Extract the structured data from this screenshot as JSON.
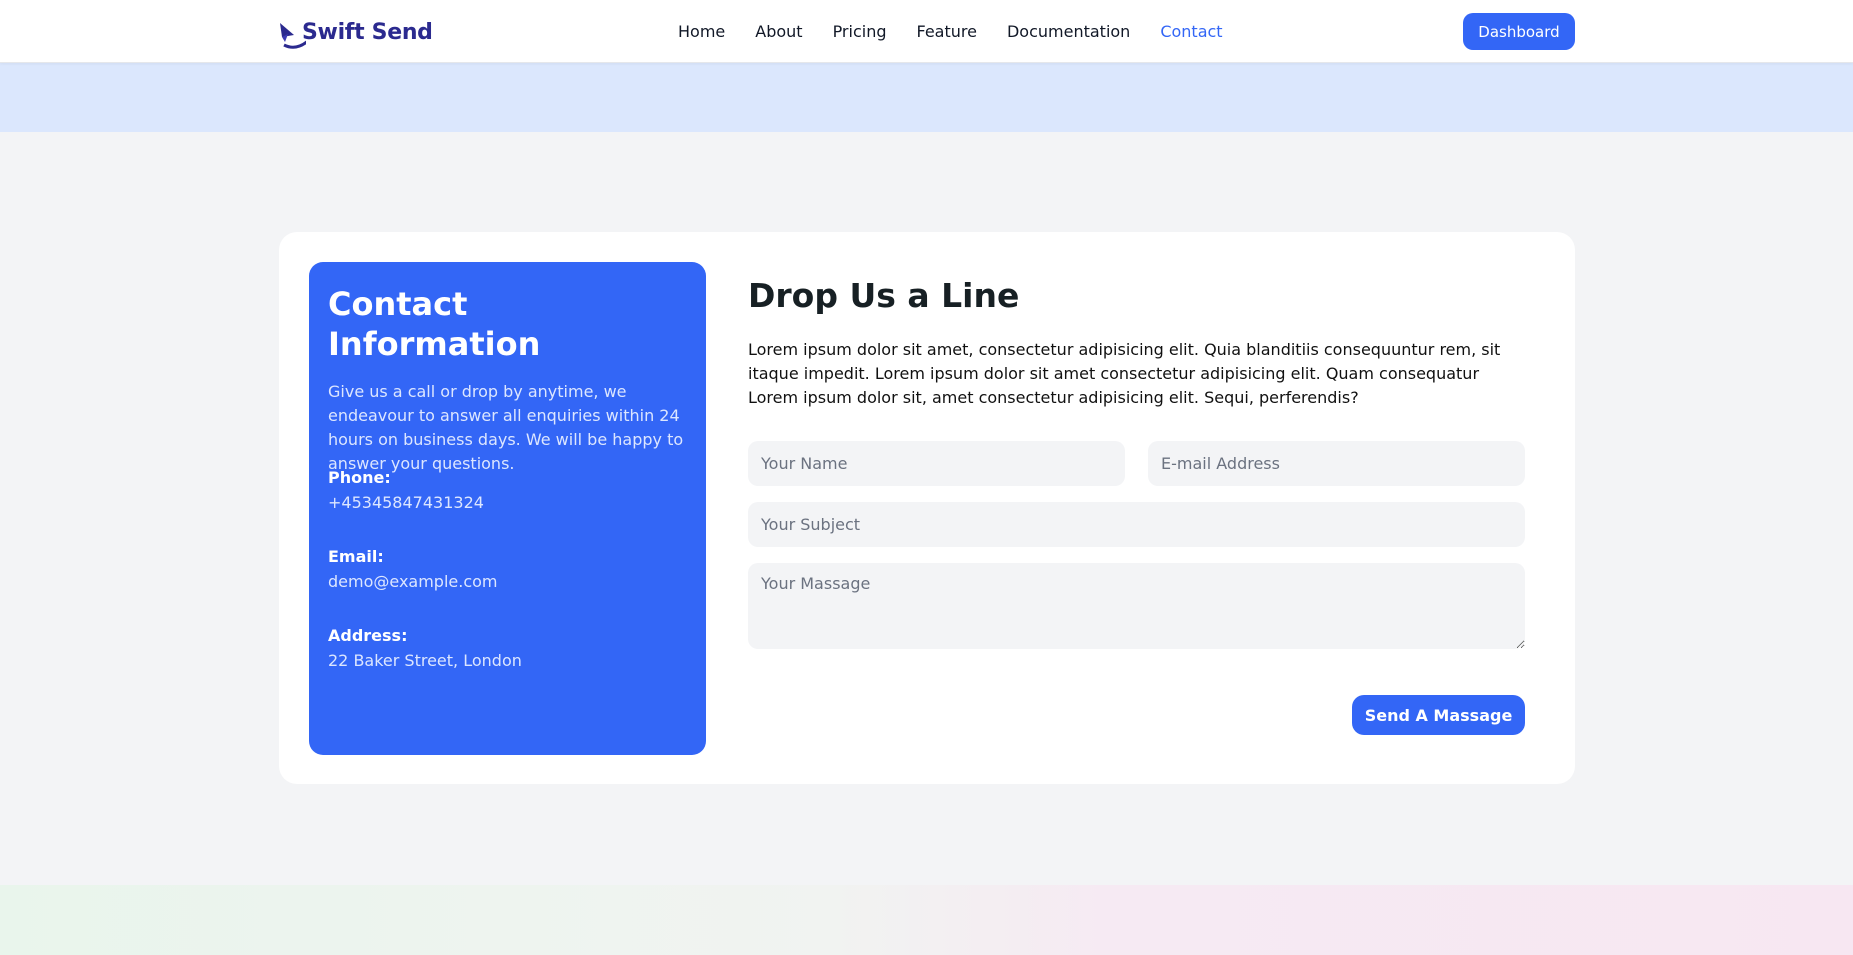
{
  "header": {
    "logo_text": "Swift Send",
    "nav": [
      {
        "label": "Home",
        "active": false
      },
      {
        "label": "About",
        "active": false
      },
      {
        "label": "Pricing",
        "active": false
      },
      {
        "label": "Feature",
        "active": false
      },
      {
        "label": "Documentation",
        "active": false
      },
      {
        "label": "Contact",
        "active": true
      }
    ],
    "dashboard_label": "Dashboard"
  },
  "contact_info": {
    "title": "Contact Information",
    "description": "Give us a call or drop by anytime, we endeavour to answer all enquiries within 24 hours on business days. We will be happy to answer your questions.",
    "phone_label": "Phone:",
    "phone_value": "+45345847431324",
    "email_label": "Email:",
    "email_value": "demo@example.com",
    "address_label": "Address:",
    "address_value": "22 Baker Street, London"
  },
  "form": {
    "title": "Drop Us a Line",
    "description": "Lorem ipsum dolor sit amet, consectetur adipisicing elit. Quia blanditiis consequuntur rem, sit itaque impedit. Lorem ipsum dolor sit amet consectetur adipisicing elit. Quam consequatur Lorem ipsum dolor sit, amet consectetur adipisicing elit. Sequi, perferendis?",
    "name_placeholder": "Your Name",
    "email_placeholder": "E-mail Address",
    "subject_placeholder": "Your Subject",
    "message_placeholder": "Your Massage",
    "submit_label": "Send A Massage"
  },
  "colors": {
    "accent": "#3366f6",
    "brand": "#2b2a8f",
    "hero_band": "#dbe7fd",
    "page_bg": "#f3f4f6"
  }
}
